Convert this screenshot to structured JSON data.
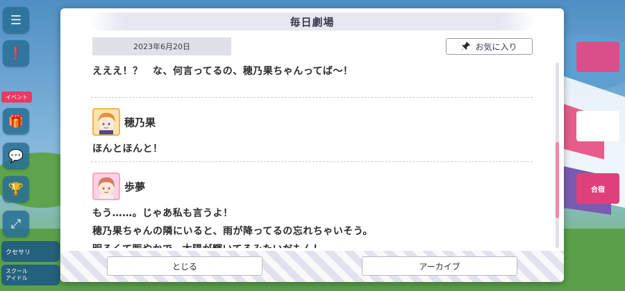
{
  "modal": {
    "title": "毎日劇場",
    "date": "2023年6月20日",
    "favorite_label": "お気に入り"
  },
  "messages": [
    {
      "speaker": "",
      "lines": [
        "えええ！？　な、何言ってるの、穂乃果ちゃんってば〜！"
      ]
    },
    {
      "speaker": "穂乃果",
      "lines": [
        "ほんとほんと！"
      ]
    },
    {
      "speaker": "歩夢",
      "lines": [
        "もう……。じゃあ私も言うよ！",
        "穂乃果ちゃんの隣にいると、雨が降ってるの忘れちゃいそう。",
        "明るくて賑やかで、太陽が輝いてるみたいだもん！"
      ]
    }
  ],
  "footer": {
    "close_label": "とじる",
    "archive_label": "アーカイブ"
  },
  "background": {
    "event_badge": "イベント",
    "closet_label": "クセサリ",
    "school_label": "スクール\nアイドル",
    "tile_label": "合宿"
  }
}
